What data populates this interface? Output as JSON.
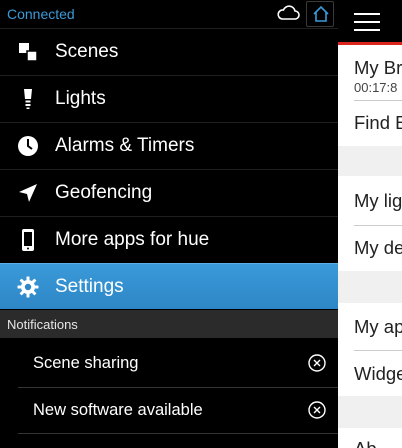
{
  "status": {
    "connection": "Connected"
  },
  "drawer": {
    "menu": [
      {
        "label": "Scenes",
        "icon": "scenes-icon"
      },
      {
        "label": "Lights",
        "icon": "bulb-icon"
      },
      {
        "label": "Alarms & Timers",
        "icon": "clock-icon"
      },
      {
        "label": "Geofencing",
        "icon": "location-arrow-icon"
      },
      {
        "label": "More apps for hue",
        "icon": "phone-icon"
      },
      {
        "label": "Settings",
        "icon": "gear-icon",
        "active": true
      }
    ],
    "notifications_header": "Notifications",
    "notifications": [
      {
        "label": "Scene sharing"
      },
      {
        "label": "New software available"
      }
    ]
  },
  "main": {
    "rows": [
      {
        "title": "My Br",
        "sub": "00:17:8"
      },
      {
        "title": "Find E"
      },
      {
        "title": "My lig"
      },
      {
        "title": "My de"
      },
      {
        "title": "My ap"
      },
      {
        "title": "Widge"
      },
      {
        "title": "Ab"
      }
    ]
  },
  "colors": {
    "accent": "#3a9ad9",
    "brand_red": "#d9251c"
  }
}
